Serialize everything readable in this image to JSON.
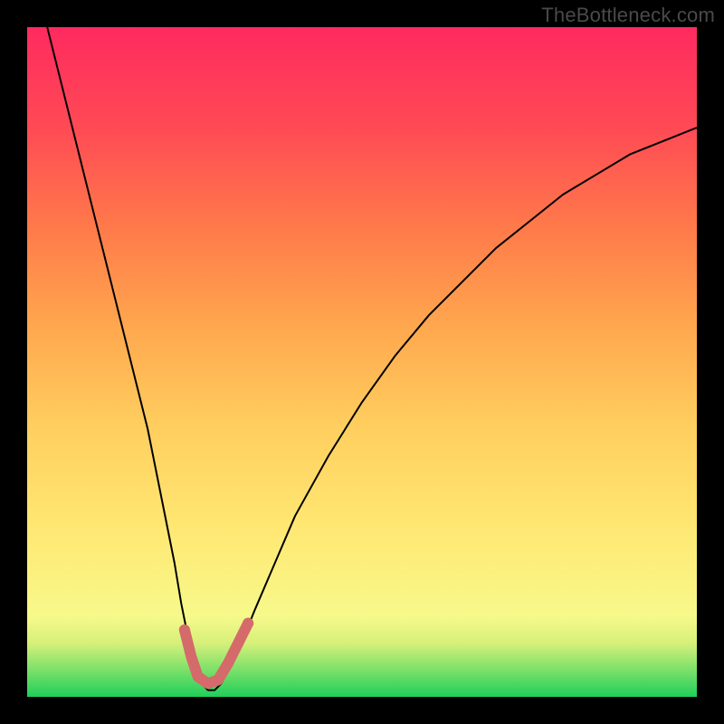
{
  "watermark": "TheBottleneck.com",
  "chart_data": {
    "type": "line",
    "title": "",
    "xlabel": "",
    "ylabel": "",
    "xlim": [
      0,
      100
    ],
    "ylim": [
      0,
      100
    ],
    "gradient_bands": [
      {
        "y": 0,
        "color": "#1fcf5a"
      },
      {
        "y": 4,
        "color": "#7be06a"
      },
      {
        "y": 8,
        "color": "#d6f07a"
      },
      {
        "y": 12,
        "color": "#f7f98a"
      },
      {
        "y": 25,
        "color": "#ffe873"
      },
      {
        "y": 40,
        "color": "#ffcf5f"
      },
      {
        "y": 55,
        "color": "#ffa84e"
      },
      {
        "y": 70,
        "color": "#ff7a4a"
      },
      {
        "y": 85,
        "color": "#ff4a55"
      },
      {
        "y": 100,
        "color": "#ff2a5f"
      }
    ],
    "series": [
      {
        "name": "bottleneck-curve",
        "stroke": "#000000",
        "stroke_width": 2,
        "points": [
          {
            "x": 3,
            "y": 100
          },
          {
            "x": 6,
            "y": 88
          },
          {
            "x": 9,
            "y": 76
          },
          {
            "x": 12,
            "y": 64
          },
          {
            "x": 15,
            "y": 52
          },
          {
            "x": 18,
            "y": 40
          },
          {
            "x": 20,
            "y": 30
          },
          {
            "x": 22,
            "y": 20
          },
          {
            "x": 23,
            "y": 14
          },
          {
            "x": 24,
            "y": 9
          },
          {
            "x": 25,
            "y": 5
          },
          {
            "x": 26,
            "y": 2
          },
          {
            "x": 27,
            "y": 1
          },
          {
            "x": 28,
            "y": 1
          },
          {
            "x": 29,
            "y": 2
          },
          {
            "x": 30,
            "y": 4
          },
          {
            "x": 32,
            "y": 8
          },
          {
            "x": 34,
            "y": 13
          },
          {
            "x": 37,
            "y": 20
          },
          {
            "x": 40,
            "y": 27
          },
          {
            "x": 45,
            "y": 36
          },
          {
            "x": 50,
            "y": 44
          },
          {
            "x": 55,
            "y": 51
          },
          {
            "x": 60,
            "y": 57
          },
          {
            "x": 65,
            "y": 62
          },
          {
            "x": 70,
            "y": 67
          },
          {
            "x": 75,
            "y": 71
          },
          {
            "x": 80,
            "y": 75
          },
          {
            "x": 85,
            "y": 78
          },
          {
            "x": 90,
            "y": 81
          },
          {
            "x": 95,
            "y": 83
          },
          {
            "x": 100,
            "y": 85
          }
        ]
      },
      {
        "name": "optimal-zone-highlight",
        "stroke": "#d56a6a",
        "stroke_width": 12,
        "points": [
          {
            "x": 23.5,
            "y": 10
          },
          {
            "x": 24.5,
            "y": 6
          },
          {
            "x": 25.5,
            "y": 3
          },
          {
            "x": 27,
            "y": 2
          },
          {
            "x": 28.5,
            "y": 2.5
          },
          {
            "x": 30,
            "y": 5
          },
          {
            "x": 31.5,
            "y": 8
          },
          {
            "x": 33,
            "y": 11
          }
        ]
      }
    ]
  }
}
